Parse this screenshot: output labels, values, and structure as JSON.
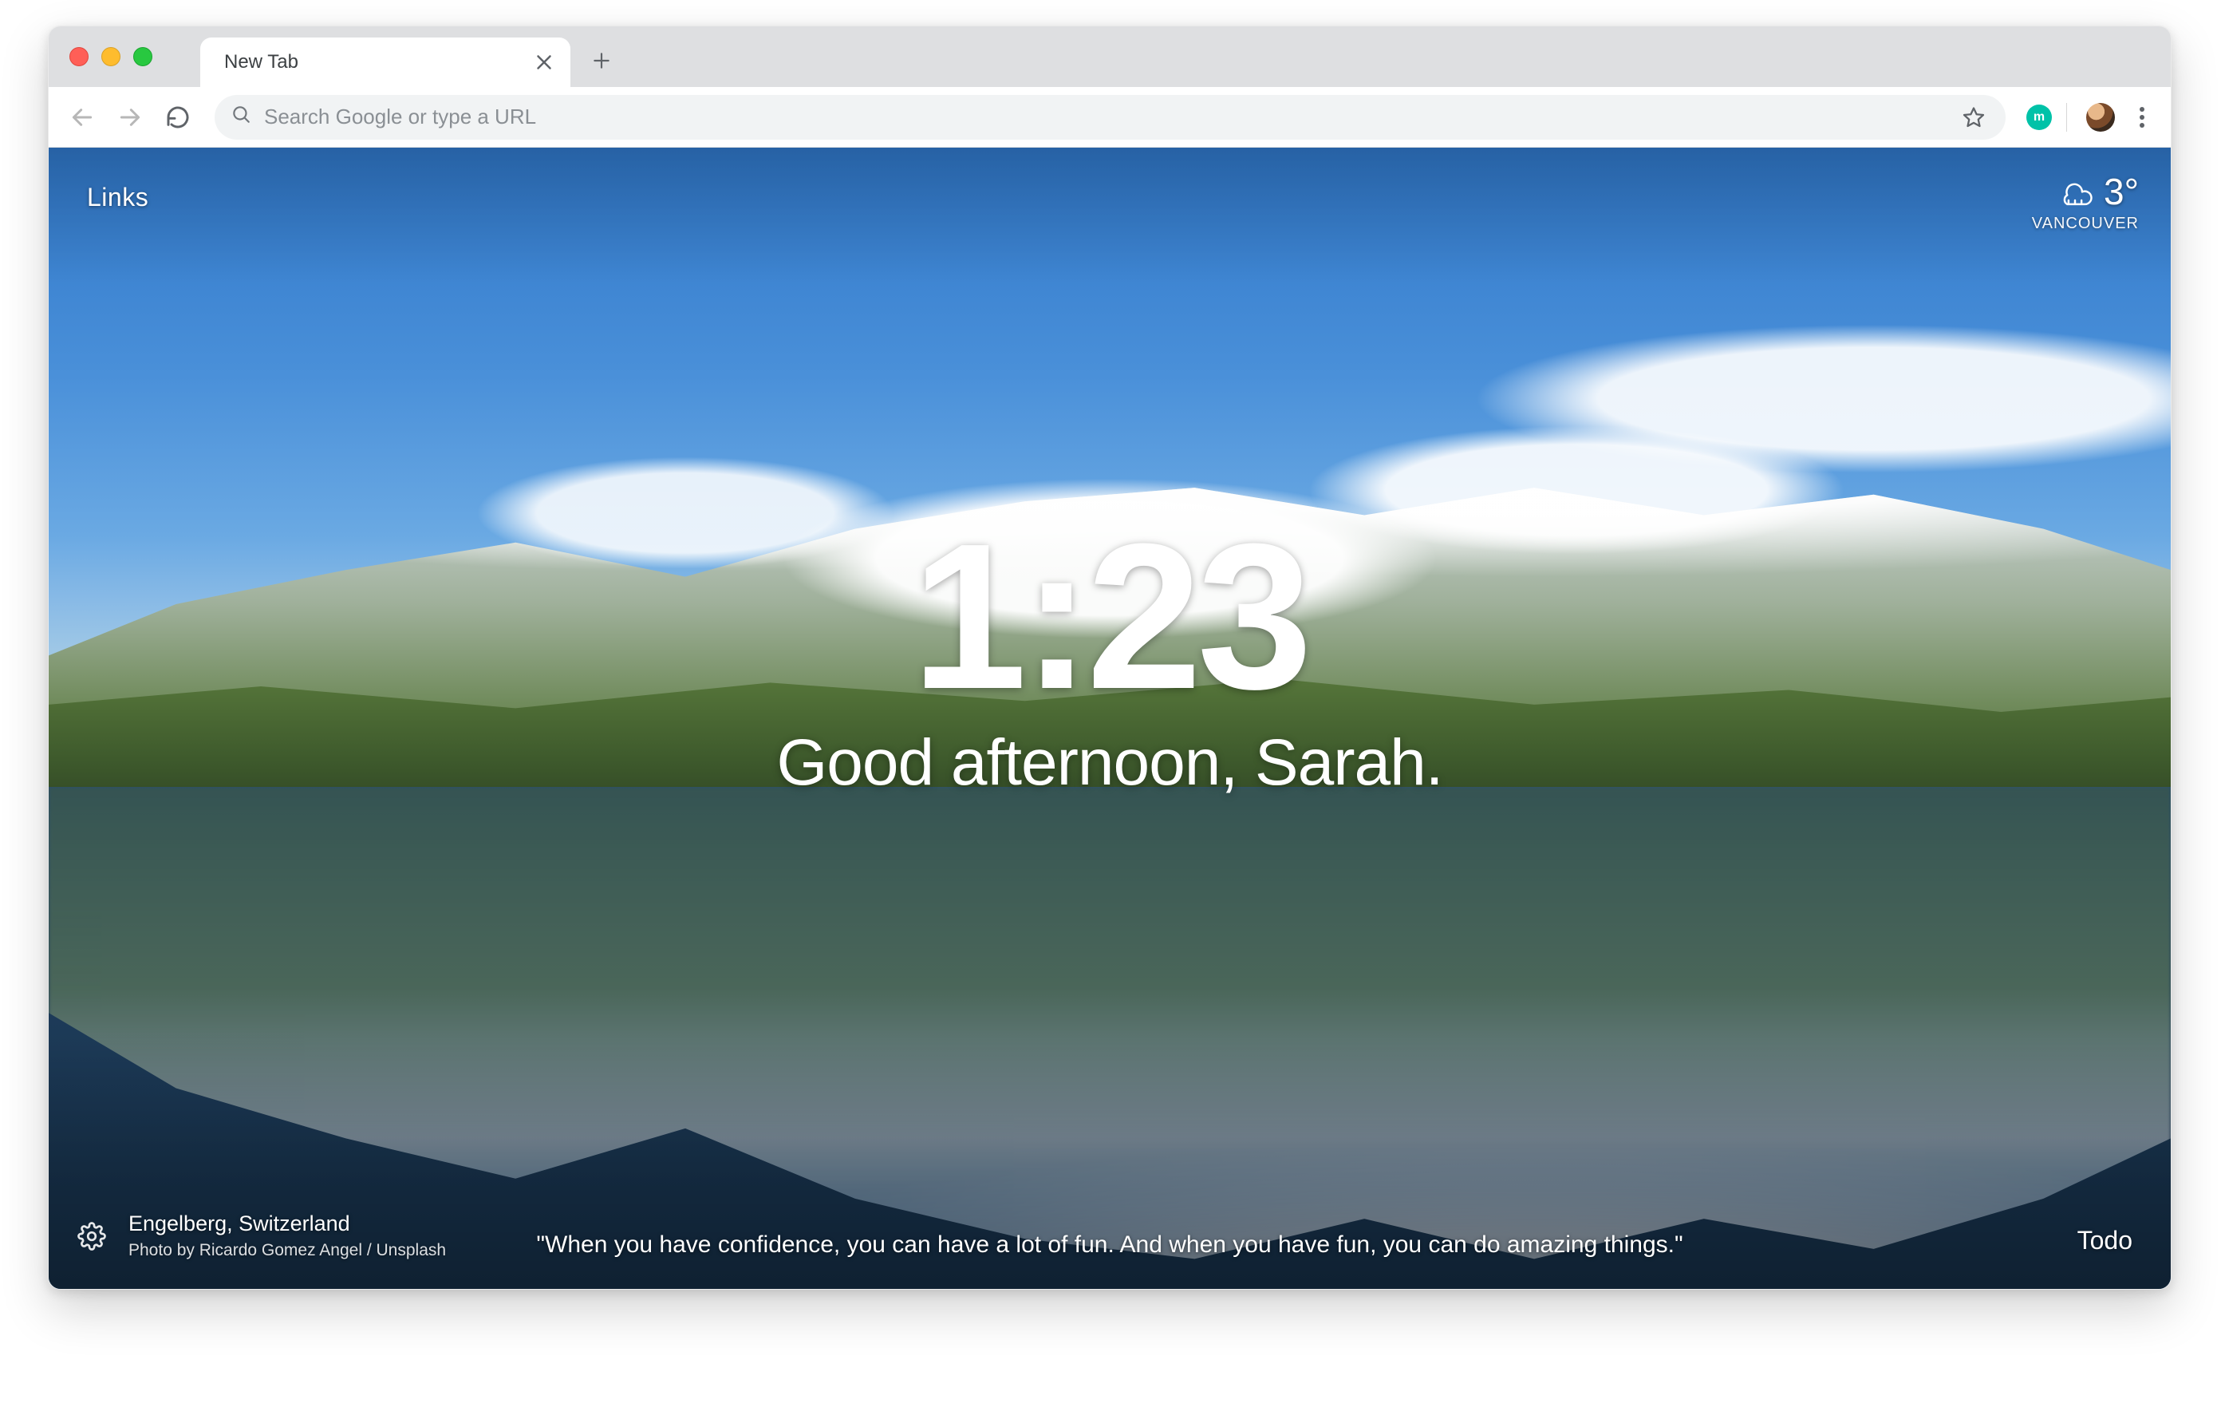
{
  "browser": {
    "tab_title": "New Tab",
    "omnibox_placeholder": "Search Google or type a URL",
    "extension_badge": "m"
  },
  "overlay": {
    "links_label": "Links",
    "weather": {
      "temp": "3°",
      "location": "VANCOUVER"
    },
    "clock": "1:23",
    "greeting": "Good afternoon, Sarah.",
    "location": "Engelberg, Switzerland",
    "photo_credit": "Photo by Ricardo Gomez Angel / Unsplash",
    "quote": "\"When you have confidence, you can have a lot of fun. And when you have fun, you can do amazing things.\"",
    "todo_label": "Todo"
  }
}
